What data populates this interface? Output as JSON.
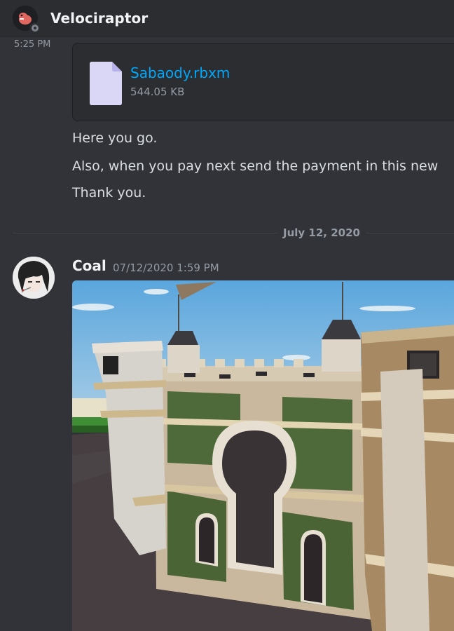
{
  "header": {
    "channel_name": "Velociraptor"
  },
  "previous_message": {
    "timestamp": "5:25 PM",
    "attachment": {
      "file_name": "Sabaody.rbxm",
      "file_size": "544.05 KB"
    },
    "lines": [
      "Here you go.",
      "Also, when you pay next send the payment in this new",
      "Thank you."
    ]
  },
  "date_divider": "July 12, 2020",
  "message": {
    "author": "Coal",
    "timestamp": "07/12/2020 1:59 PM"
  },
  "colors": {
    "background": "#313338",
    "header": "#2b2d31",
    "link": "#00a8fc",
    "muted": "#949ba4"
  }
}
